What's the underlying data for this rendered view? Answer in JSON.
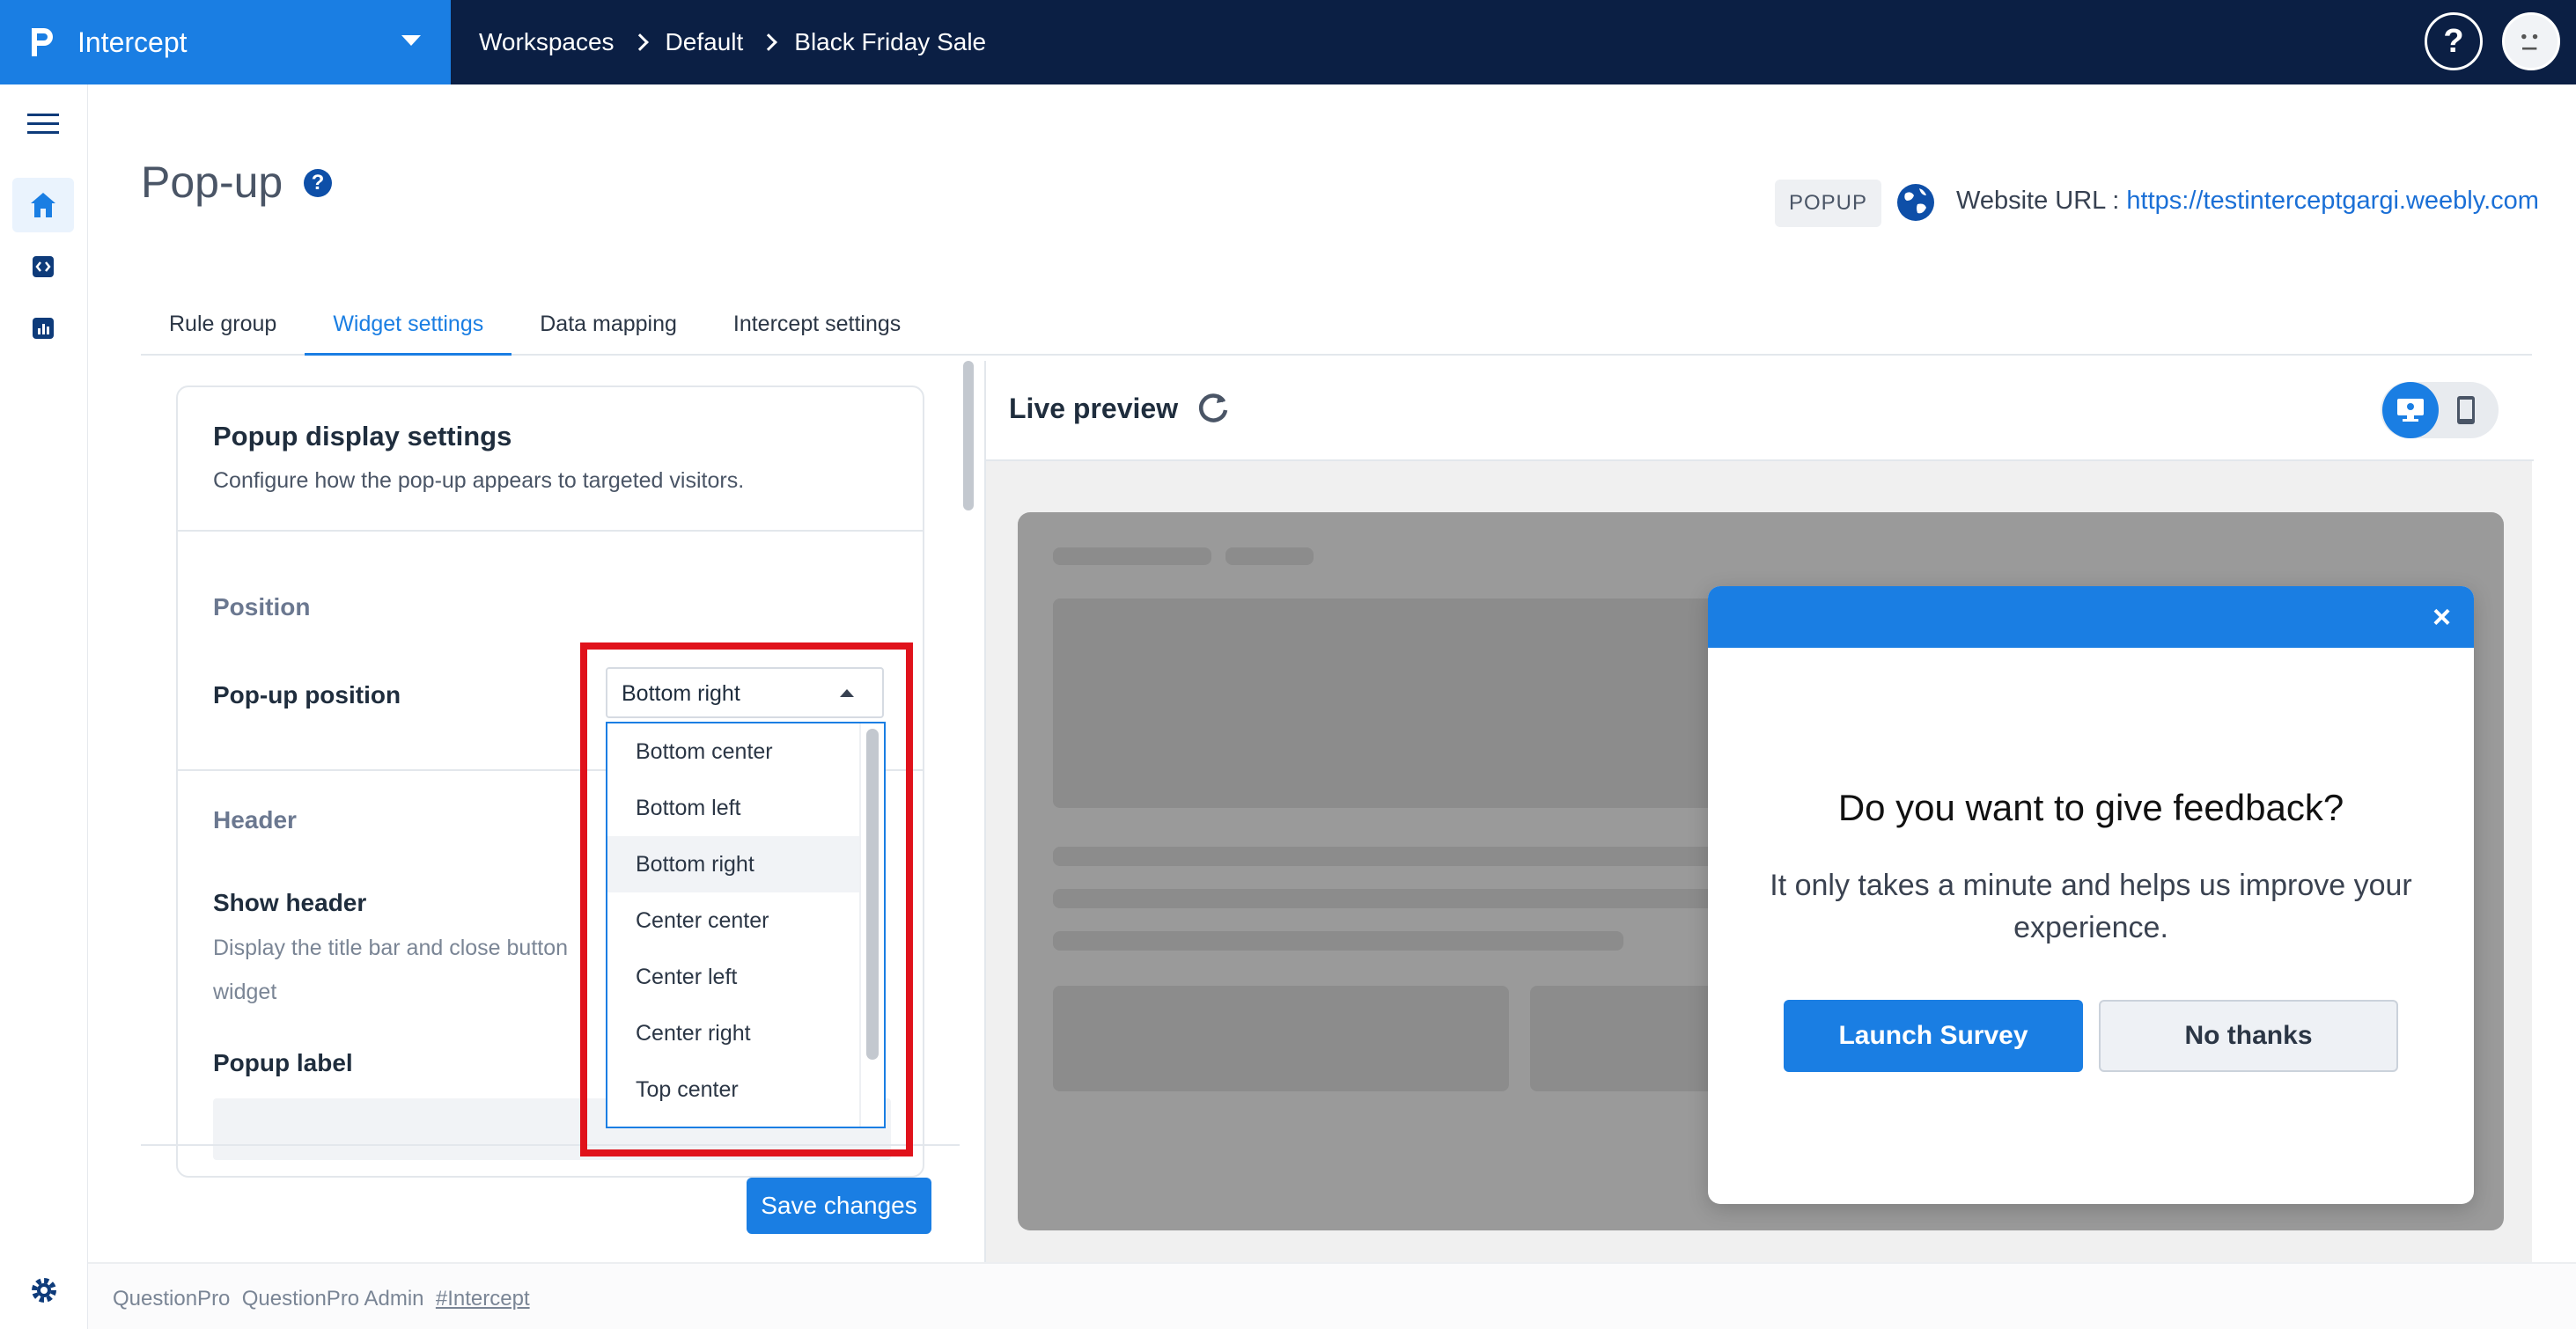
{
  "app": {
    "name": "Intercept"
  },
  "breadcrumb": [
    "Workspaces",
    "Default",
    "Black Friday Sale"
  ],
  "header_icons": {
    "help": "?",
    "avatar": "profile-avatar"
  },
  "page": {
    "title": "Pop-up",
    "badge": "POPUP",
    "url_label": "Website URL : ",
    "url": "https://testinterceptgargi.weebly.com"
  },
  "tabs": [
    {
      "label": "Rule group",
      "active": false
    },
    {
      "label": "Widget settings",
      "active": true
    },
    {
      "label": "Data mapping",
      "active": false
    },
    {
      "label": "Intercept settings",
      "active": false
    }
  ],
  "settings": {
    "title": "Popup display settings",
    "subtitle": "Configure how the pop-up appears to targeted visitors.",
    "position_section": "Position",
    "position_label": "Pop-up position",
    "position_value": "Bottom right",
    "position_options": [
      "Bottom center",
      "Bottom left",
      "Bottom right",
      "Center center",
      "Center left",
      "Center right",
      "Top center"
    ],
    "selected_option_index": 2,
    "header_section": "Header",
    "show_header_label": "Show header",
    "show_header_desc": "Display the title bar and close button",
    "show_header_desc_2": "widget",
    "popup_label": "Popup label",
    "save_label": "Save changes"
  },
  "preview": {
    "title": "Live preview",
    "device_selected": "desktop",
    "popup": {
      "close": "×",
      "title": "Do you want to give feedback?",
      "text": "It only takes a minute and helps us improve your experience.",
      "launch_label": "Launch Survey",
      "no_thanks_label": "No thanks"
    }
  },
  "footer": {
    "org": "QuestionPro",
    "user": "QuestionPro Admin",
    "tag": "#Intercept"
  },
  "colors": {
    "topbar": "#0b1f44",
    "brand": "#1a7ee3",
    "accent": "#1a7ee3",
    "highlight": "#e0121b"
  },
  "icons": [
    "menu-icon",
    "home-icon",
    "code-icon",
    "chart-icon",
    "settings-gear-icon",
    "globe-icon",
    "refresh-icon",
    "desktop-icon",
    "mobile-icon",
    "help-icon"
  ]
}
